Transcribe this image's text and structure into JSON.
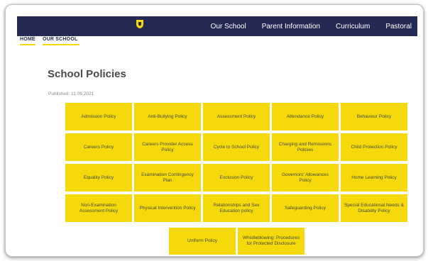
{
  "nav": {
    "items": [
      "Our School",
      "Parent Information",
      "Curriculum",
      "Pastoral"
    ]
  },
  "breadcrumb": [
    "HOME",
    "OUR SCHOOL"
  ],
  "page": {
    "title": "School Policies",
    "published": "Published: 11.09.2021"
  },
  "policies": [
    "Admission Policy",
    "Anti-Bullying Policy",
    "Assessment Policy",
    "Attendance Policy",
    "Behaviour Policy",
    "Careers Policy",
    "Careers Provider Access Policy",
    "Cycle to School Policy",
    "Charging and Remissions Policies",
    "Child Protection Policy",
    "Equality Policy",
    "Examination Contingency Plan",
    "Exclusion Policy",
    "Governors' Allowances Policy",
    "Home Learning Policy",
    "Non-Examination Assessment Policy",
    "Physical Intervention Policy",
    "Relationships and Sex Education policy",
    "Safeguarding Policy",
    "Special Educational Needs & Disability Policy",
    "Uniform Policy",
    "Whistleblowing: Procedures for Protected Disclosure"
  ],
  "colors": {
    "nav_bg": "#232a54",
    "tile_bg": "#f5d90a",
    "accent": "#f5d90a"
  }
}
